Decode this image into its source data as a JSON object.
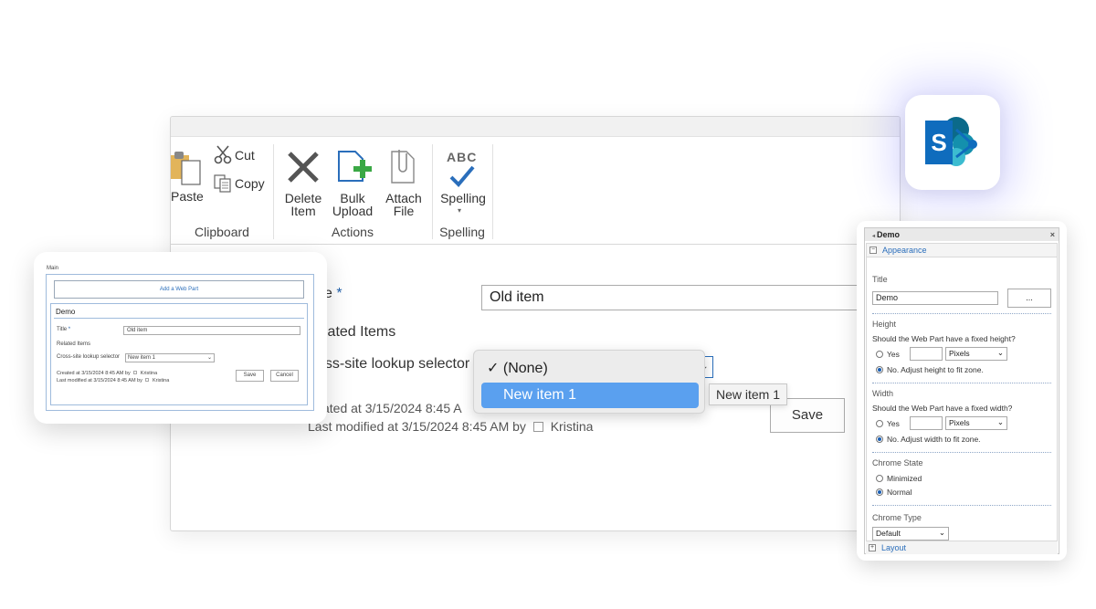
{
  "ribbon": {
    "clipboard": {
      "paste": "Paste",
      "cut": "Cut",
      "copy": "Copy",
      "group": "Clipboard"
    },
    "actions": {
      "delete_l1": "Delete",
      "delete_l2": "Item",
      "bulk_l1": "Bulk",
      "bulk_l2": "Upload",
      "attach_l1": "Attach",
      "attach_l2": "File",
      "group": "Actions"
    },
    "spelling": {
      "abc": "ABC",
      "label": "Spelling",
      "group": "Spelling"
    }
  },
  "form": {
    "title_label": "e",
    "required_mark": "*",
    "title_value": "Old item",
    "related_label": "lated Items",
    "lookup_label": "oss-site lookup selector",
    "created": "ated at 3/15/2024 8:45 A",
    "modified_prefix": "Last modified at 3/15/2024 8:45 AM  by",
    "modified_user": "Kristina",
    "save": "Save"
  },
  "dropdown": {
    "options": [
      {
        "label": "(None)",
        "checked": true
      },
      {
        "label": "New item 1",
        "checked": false
      }
    ],
    "tooltip": "New item 1"
  },
  "mini": {
    "main": "Main",
    "add_web_part": "Add a Web Part",
    "webpart_title": "Demo",
    "title_label": "Title",
    "req": "*",
    "title_value": "Old item",
    "related": "Related Items",
    "lookup_label": "Cross-site lookup selector",
    "lookup_value": "New item 1",
    "created": "Created at 3/15/2024 8:45 AM  by",
    "created_user": "Kristina",
    "modified": "Last modified at 3/15/2024 8:45 AM  by",
    "modified_user": "Kristina",
    "save": "Save",
    "cancel": "Cancel"
  },
  "pane": {
    "title": "Demo",
    "appearance": "Appearance",
    "title_label": "Title",
    "title_value": "Demo",
    "browse": "...",
    "height": "Height",
    "height_q": "Should the Web Part have a fixed height?",
    "yes": "Yes",
    "pixels": "Pixels",
    "height_no": "No. Adjust height to fit zone.",
    "width": "Width",
    "width_q": "Should the Web Part have a fixed width?",
    "width_no": "No. Adjust width to fit zone.",
    "chrome_state": "Chrome State",
    "minimized": "Minimized",
    "normal": "Normal",
    "chrome_type": "Chrome Type",
    "chrome_type_value": "Default",
    "layout": "Layout"
  },
  "colors": {
    "sharepoint": "#0f6cbd",
    "accent": "#2a6ebb",
    "selection": "#5aa0ef"
  }
}
